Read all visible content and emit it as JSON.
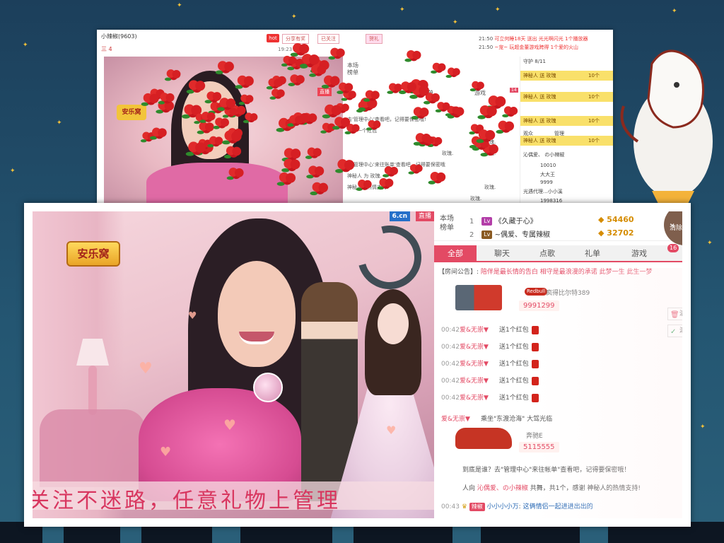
{
  "back_window": {
    "room_title": "小辣椒(9603)",
    "level_text": "三 4",
    "hot_label": "hot",
    "share_label": "分享有奖",
    "follow_label": "已关注",
    "report_label": "贺礼",
    "time_label": "19:23",
    "news": [
      {
        "time": "21:50",
        "text": "可立何睡18天 送出 光光啊闪光 1个播放器"
      },
      {
        "time": "21:50",
        "text": "~宠~ 玩超金董游戏跨得 1个爱的火山"
      }
    ],
    "live_label": "直播",
    "badge_text": "安乐窝",
    "rank_title": "本场榜单",
    "tabs": [
      "礼单",
      "游戏"
    ],
    "tab_count": "14",
    "guard_label": "守护",
    "guard_count": "8/11",
    "audience_label": "观众",
    "admin_label": "管理",
    "chat_lines": [
      "去'管理中心'查看吧，记得要保密哦!",
      "送了一个红包",
      "玫瑰.",
      "玫瑰.",
      "去'管理中心'来往账单'查看吧，记得要保密哦",
      "神秘人 为 玫瑰.",
      "神秘人的热情支持!",
      "玫瑰.",
      "玫瑰.",
      "玫瑰."
    ],
    "gifts": [
      {
        "user": "神秘人",
        "what": "送 玫瑰",
        "count": "10个"
      },
      {
        "user": "神秘人",
        "what": "送 玫瑰",
        "count": "10个"
      },
      {
        "user": "神秘人",
        "what": "送 玫瑰",
        "count": "10个"
      },
      {
        "user": "神秘人",
        "what": "送 玫瑰",
        "count": "10个"
      }
    ],
    "side_lines": [
      "沁偶爱、 の小辣椒",
      "10010",
      "大大王",
      "9999",
      "光遇代理...小小溪",
      "1998316"
    ]
  },
  "front_window": {
    "logo_6cn": "6.cn",
    "live_label": "直播",
    "badge_text": "安乐窝",
    "caption": "关注不迷路，任意礼物上管理",
    "rank": {
      "title": "本场榜单",
      "rows": [
        {
          "no": "1",
          "level_color": "#b33ea8",
          "name": "《久藏于心》",
          "score": "54460"
        },
        {
          "no": "2",
          "level_color": "#8a5a22",
          "name": "~偶爱、专属辣椒",
          "score": "32702"
        }
      ]
    },
    "clear_button_label": "清除特效",
    "tabs": [
      {
        "label": "全部",
        "active": true
      },
      {
        "label": "聊天",
        "active": false
      },
      {
        "label": "点歌",
        "active": false
      },
      {
        "label": "礼单",
        "active": false
      },
      {
        "label": "游戏",
        "active": false
      }
    ],
    "tab_count": "16",
    "notice_label": "【房间公告】:",
    "notice_text": "陪伴是最长情的告白 相守是最浪漫的承诺 此梦一生 此生一梦",
    "gift1": {
      "brand": "Redbull",
      "user": "疯得比尔特389",
      "number": "9991299"
    },
    "messages": [
      {
        "time": "00:42",
        "user": "爱&无崇▼",
        "text": "送1个红包"
      },
      {
        "time": "00:42",
        "user": "爱&无崇▼",
        "text": "送1个红包"
      },
      {
        "time": "00:42",
        "user": "爱&无崇▼",
        "text": "送1个红包"
      },
      {
        "time": "00:42",
        "user": "爱&无崇▼",
        "text": "送1个红包"
      },
      {
        "time": "00:42",
        "user": "爱&无崇▼",
        "text": "送1个红包"
      }
    ],
    "clear_screen_label": "清屏",
    "scroll_label": "滚屏",
    "car_line": {
      "user": "爱&无崇▼",
      "text": "乘坐\"东渡沧海\" 大驾光临"
    },
    "gift2": {
      "brand": "奔驰E",
      "number": "5115555"
    },
    "sys_line1": "到底是谁？去\"管理中心\"来往帐单\"查看吧，记得要保密哦！",
    "sys_line2": {
      "prefix": "人向",
      "target": "沁偶爱、の小辣椒",
      "action": "共舞，共1个，感谢",
      "user": "神秘人的热情支持!"
    },
    "last_msg": {
      "time": "00:43",
      "tag": "辣椒",
      "user": "小小小小万",
      "text": "这俩情侣一起进进出出的"
    }
  }
}
